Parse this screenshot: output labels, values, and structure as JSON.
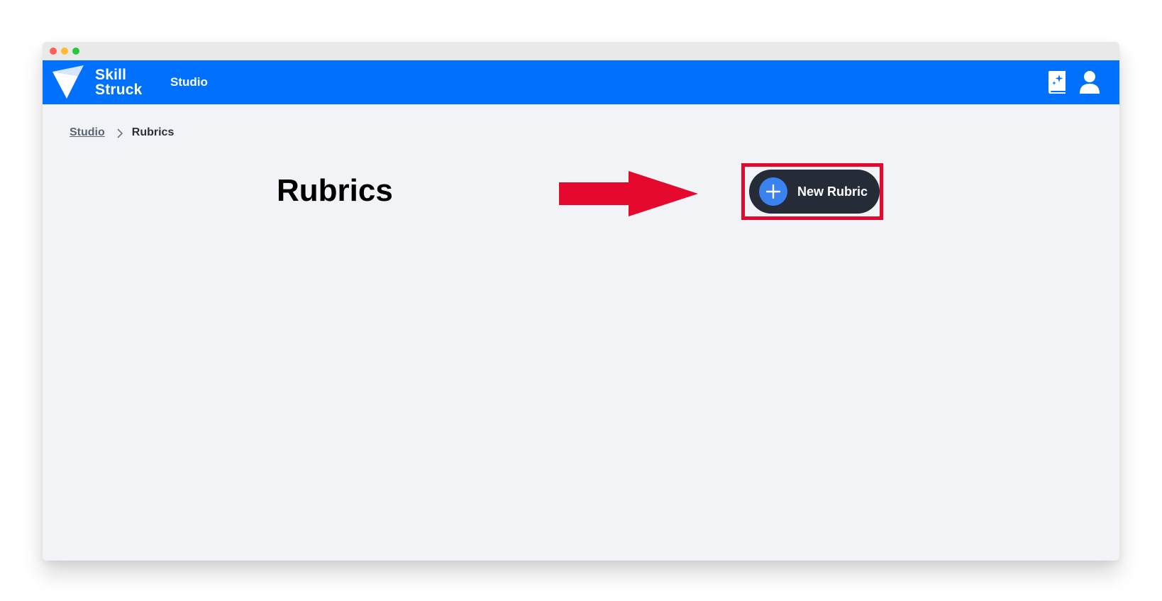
{
  "colors": {
    "brand_blue": "#0070ff",
    "page_bg": "#f2f3f7",
    "button_dark": "#262b38",
    "button_accent": "#3a82f0",
    "annotation_red": "#e3082c",
    "close_dot": "#fe5f57",
    "minimize_dot": "#febc2e",
    "zoom_dot": "#28c840"
  },
  "navbar": {
    "brand_line1": "Skill",
    "brand_line2": "Struck",
    "studio_link": "Studio",
    "icons": [
      "ai-book-icon",
      "user-icon"
    ]
  },
  "breadcrumb": {
    "items": [
      {
        "label": "Studio",
        "link": true
      },
      {
        "label": "Rubrics",
        "link": false
      }
    ]
  },
  "main": {
    "title": "Rubrics",
    "new_button_label": "New Rubric"
  }
}
